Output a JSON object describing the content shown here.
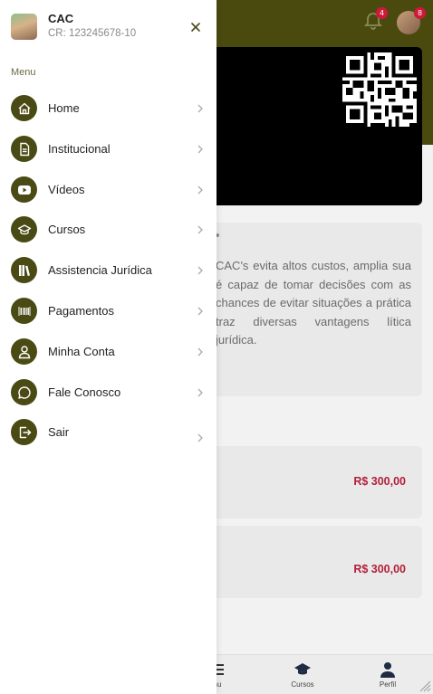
{
  "colors": {
    "brand": "#4a4a14",
    "header_bg": "#4a4a0f",
    "price": "#b3203a",
    "badge": "#d0183a"
  },
  "header": {
    "notifications_badge": "4",
    "profile_badge": "8"
  },
  "info_card": {
    "text": "CAC's evita altos custos, amplia sua é capaz de tomar decisões com as chances de evitar situações a prática traz diversas vantagens lítica jurídica."
  },
  "price_cards": [
    {
      "price": "R$ 300,00"
    },
    {
      "price": "R$ 300,00"
    }
  ],
  "bottom_nav": {
    "items": [
      {
        "label": "nu",
        "icon": "menu-icon"
      },
      {
        "label": "Cursos",
        "icon": "graduation-cap-icon"
      },
      {
        "label": "Perfil",
        "icon": "user-icon"
      }
    ]
  },
  "drawer": {
    "user": {
      "name": "CAC",
      "cr": "CR: 123245678-10"
    },
    "menu_heading": "Menu",
    "items": [
      {
        "label": "Home",
        "icon": "home-icon"
      },
      {
        "label": "Institucional",
        "icon": "document-icon"
      },
      {
        "label": "Vídeos",
        "icon": "video-play-icon"
      },
      {
        "label": "Cursos",
        "icon": "graduation-cap-icon"
      },
      {
        "label": "Assistencia Jurídica",
        "icon": "books-icon"
      },
      {
        "label": "Pagamentos",
        "icon": "barcode-icon"
      },
      {
        "label": "Minha Conta",
        "icon": "user-icon"
      },
      {
        "label": "Fale Conosco",
        "icon": "chat-bubble-icon"
      },
      {
        "label": "Sair",
        "icon": "logout-icon"
      }
    ]
  }
}
